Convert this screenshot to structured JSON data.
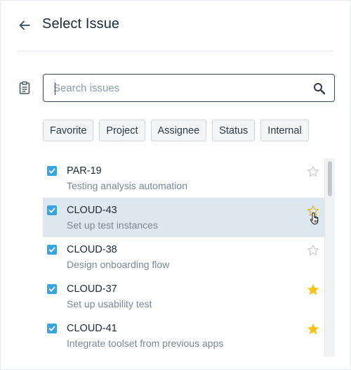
{
  "header": {
    "title": "Select Issue"
  },
  "search": {
    "placeholder": "Search issues",
    "value": ""
  },
  "filters": [
    {
      "label": "Favorite"
    },
    {
      "label": "Project"
    },
    {
      "label": "Assignee"
    },
    {
      "label": "Status"
    },
    {
      "label": "Internal"
    }
  ],
  "issues": [
    {
      "key": "PAR-19",
      "summary": "Testing analysis automation",
      "checked": true,
      "favorite": false,
      "hovered": false
    },
    {
      "key": "CLOUD-43",
      "summary": "Set up test instances",
      "checked": true,
      "favorite": false,
      "hovered": true
    },
    {
      "key": "CLOUD-38",
      "summary": "Design onboarding flow",
      "checked": true,
      "favorite": false,
      "hovered": false
    },
    {
      "key": "CLOUD-37",
      "summary": "Set up usability test",
      "checked": true,
      "favorite": true,
      "hovered": false
    },
    {
      "key": "CLOUD-41",
      "summary": "Integrate toolset from previous apps",
      "checked": true,
      "favorite": true,
      "hovered": false
    }
  ],
  "icons": {
    "back": "arrow-left-icon",
    "clipboard": "clipboard-icon",
    "search": "search-icon",
    "checkbox": "checkbox-checked-icon",
    "star": "star-icon",
    "cursor": "hand-pointer-icon"
  },
  "colors": {
    "accent": "#3aa5dd",
    "hover_row": "#dde7ef",
    "star_filled": "#f5c518",
    "star_hover_outline": "#e0b83a",
    "star_empty": "#c9ced4"
  }
}
